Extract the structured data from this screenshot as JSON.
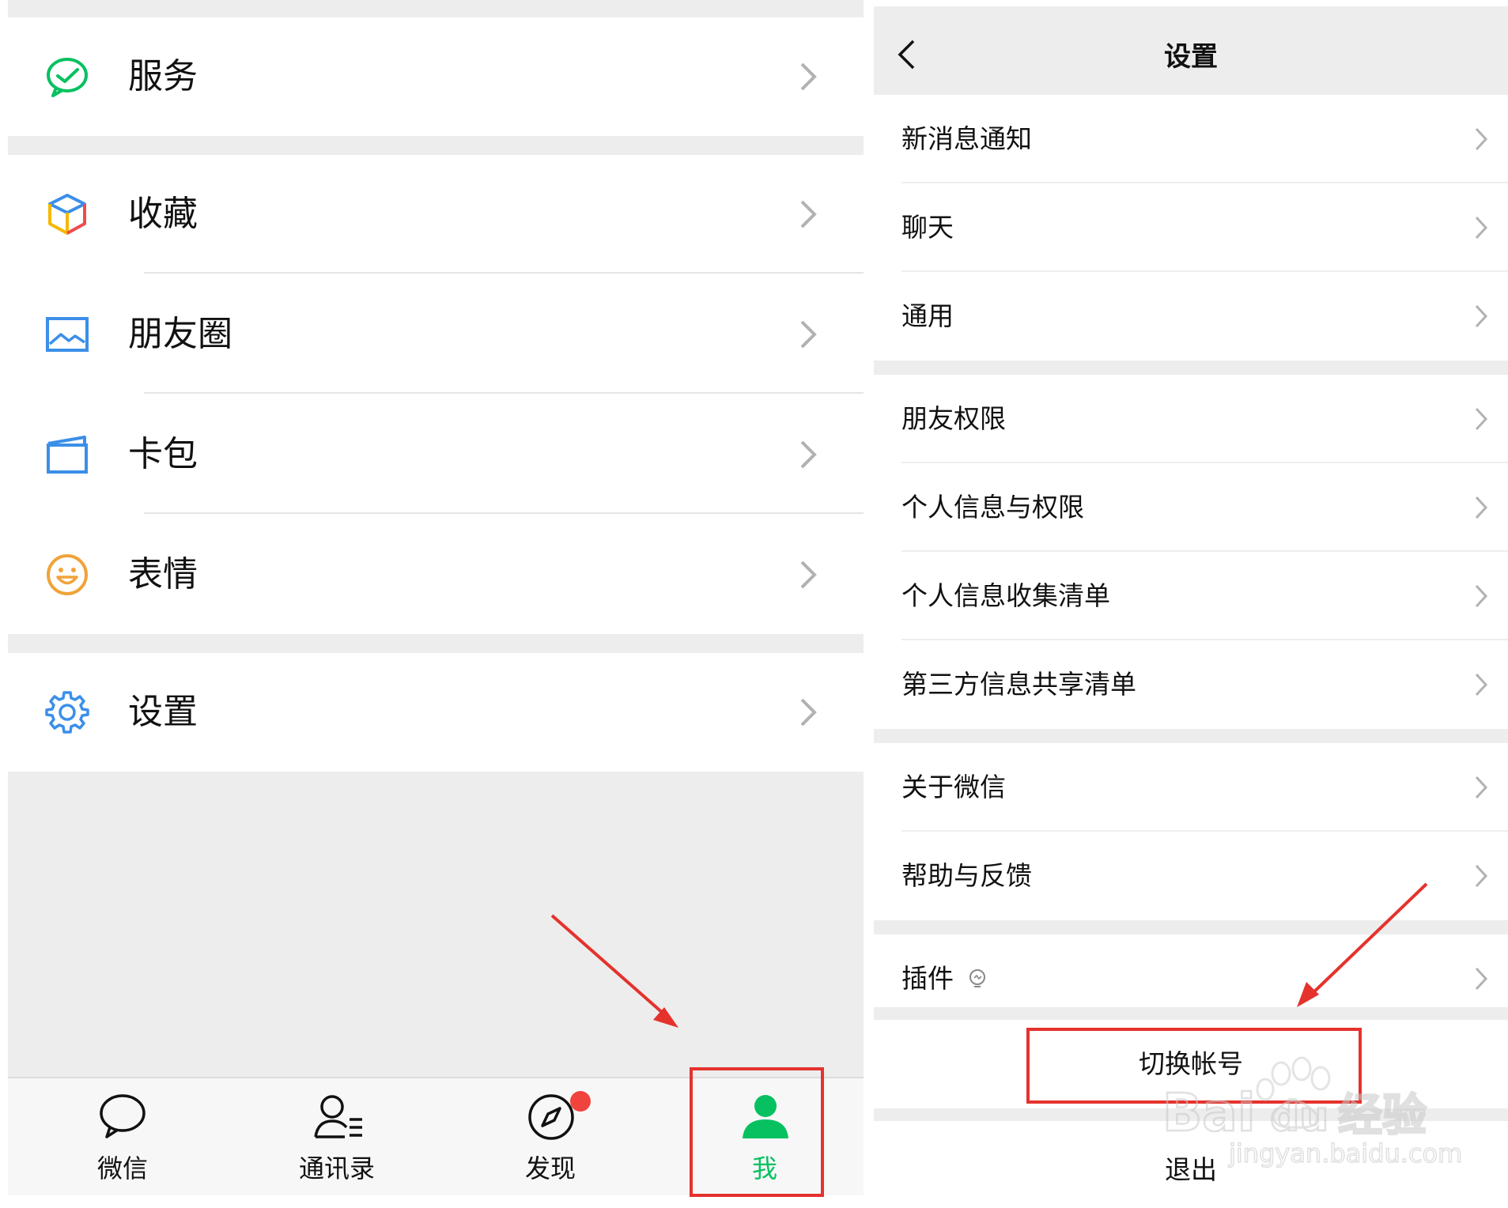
{
  "left_screen": {
    "menu": [
      {
        "label": "服务",
        "icon": "service-icon"
      },
      {
        "label": "收藏",
        "icon": "favorites-cube-icon"
      },
      {
        "label": "朋友圈",
        "icon": "moments-picture-icon"
      },
      {
        "label": "卡包",
        "icon": "card-wallet-icon"
      },
      {
        "label": "表情",
        "icon": "sticker-smiley-icon"
      },
      {
        "label": "设置",
        "icon": "settings-gear-icon"
      }
    ],
    "tabs": [
      {
        "label": "微信",
        "icon": "chat-bubble-icon"
      },
      {
        "label": "通讯录",
        "icon": "contacts-icon"
      },
      {
        "label": "发现",
        "icon": "discover-compass-icon"
      },
      {
        "label": "我",
        "icon": "me-person-icon"
      }
    ]
  },
  "right_screen": {
    "header": {
      "title": "设置"
    },
    "items": [
      {
        "label": "新消息通知"
      },
      {
        "label": "聊天"
      },
      {
        "label": "通用"
      },
      {
        "label": "朋友权限"
      },
      {
        "label": "个人信息与权限"
      },
      {
        "label": "个人信息收集清单"
      },
      {
        "label": "第三方信息共享清单"
      },
      {
        "label": "关于微信"
      },
      {
        "label": "帮助与反馈"
      },
      {
        "label": "插件"
      }
    ],
    "switch_account_label": "切换帐号",
    "logout_label": "退出"
  },
  "watermark": {
    "brand": "Bai",
    "brand2": "du",
    "brand_cn": "经验",
    "url": "jingyan.baidu.com"
  },
  "colors": {
    "accent_green": "#07c160",
    "annotation_red": "#e5322d",
    "badge_red": "#f0433e",
    "gap_gray": "#ededed"
  }
}
